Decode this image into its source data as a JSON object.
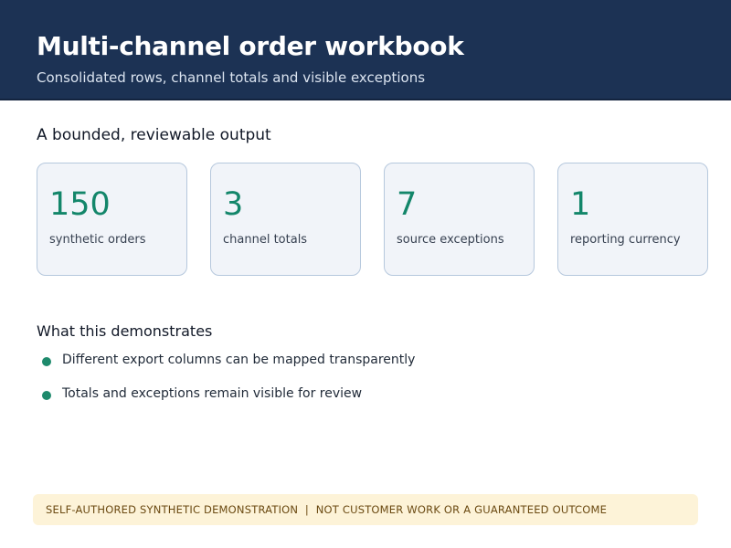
{
  "header": {
    "title": "Multi-channel order workbook",
    "subtitle": "Consolidated rows, channel totals and visible exceptions"
  },
  "summary": {
    "title": "A bounded, reviewable output",
    "cards": [
      {
        "value": "150",
        "label": "synthetic orders"
      },
      {
        "value": "3",
        "label": "channel totals"
      },
      {
        "value": "7",
        "label": "source exceptions"
      },
      {
        "value": "1",
        "label": "reporting currency"
      }
    ]
  },
  "demonstrates": {
    "title": "What this demonstrates",
    "items": [
      "Different export columns can be mapped transparently",
      "Totals and exceptions remain visible for review"
    ]
  },
  "disclaimer": {
    "text": "SELF-AUTHORED SYNTHETIC DEMONSTRATION  |  NOT CUSTOMER WORK OR A GUARANTEED OUTCOME"
  },
  "colors": {
    "header_bg": "#1c3254",
    "accent": "#13866a",
    "card_bg": "#f1f4f9",
    "disclaimer_bg": "#fdf3d8"
  }
}
